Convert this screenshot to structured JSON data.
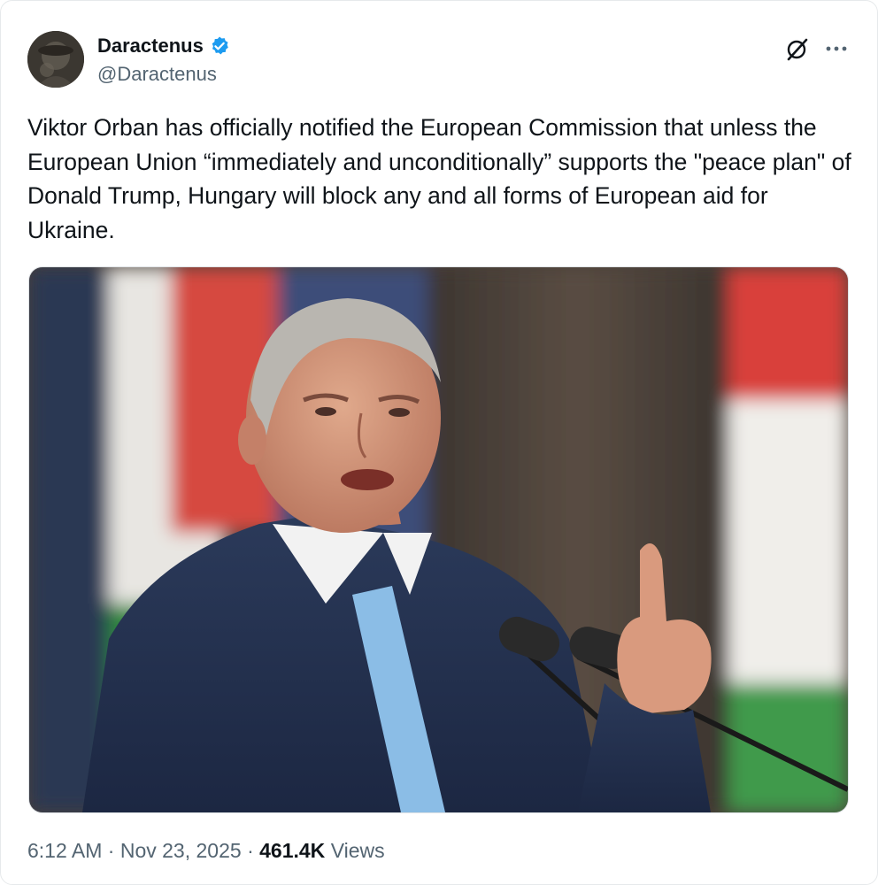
{
  "author": {
    "display_name": "Daractenus",
    "handle": "@Daractenus",
    "verified": true,
    "avatar_icon": "user-avatar",
    "verified_icon": "verified-badge-icon"
  },
  "header_actions": {
    "grok_icon": "grok-icon",
    "more_icon": "more-icon"
  },
  "tweet": {
    "text": "Viktor Orban has officially notified the European Commission that unless the European Union “immediately and unconditionally” supports the \"peace plan\" of Donald Trump, Hungary will block any and all forms of European aid for Ukraine."
  },
  "media": {
    "type": "photo"
  },
  "footer": {
    "time": "6:12 AM",
    "separator": "·",
    "date": "Nov 23, 2025",
    "views_count": "461.4K",
    "views_label": "Views"
  },
  "colors": {
    "verified_blue": "#1d9bf0",
    "text_primary": "#0f1419",
    "text_secondary": "#536471",
    "flag_red": "#d9403a",
    "flag_white": "#f4f4f2",
    "flag_green": "#2f8a3e"
  }
}
